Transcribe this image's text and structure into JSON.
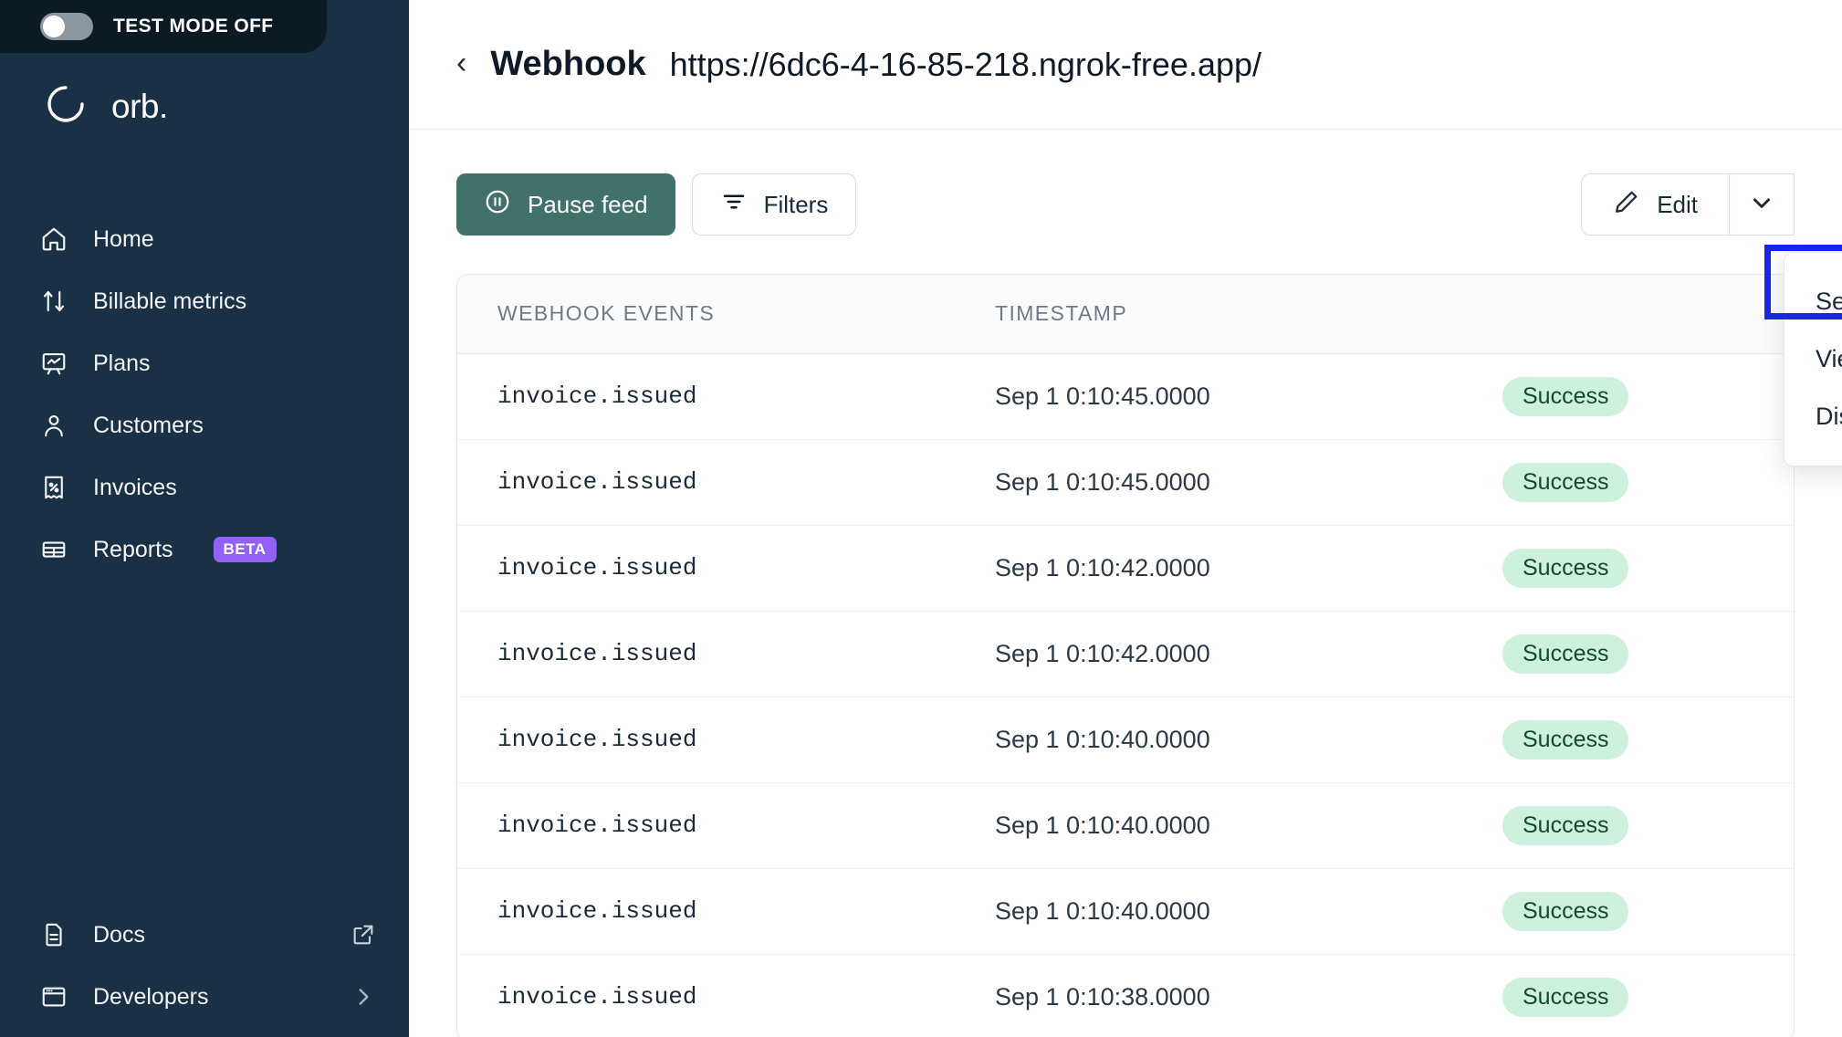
{
  "sidebar": {
    "test_mode": {
      "label": "TEST MODE OFF",
      "state": "off"
    },
    "brand": {
      "name": "orb.",
      "logo_icon": "orb-circle-icon"
    },
    "items": [
      {
        "label": "Home",
        "icon": "home-icon"
      },
      {
        "label": "Billable metrics",
        "icon": "arrows-up-down-icon"
      },
      {
        "label": "Plans",
        "icon": "presentation-chart-icon"
      },
      {
        "label": "Customers",
        "icon": "users-icon"
      },
      {
        "label": "Invoices",
        "icon": "invoice-receipt-icon"
      },
      {
        "label": "Reports",
        "icon": "table-icon",
        "badge": "BETA"
      }
    ],
    "bottom_items": [
      {
        "label": "Docs",
        "icon": "document-icon",
        "trailing_icon": "external-link-icon"
      },
      {
        "label": "Developers",
        "icon": "browser-window-icon",
        "trailing_icon": "chevron-right-icon"
      }
    ]
  },
  "header": {
    "back_icon": "chevron-left-icon",
    "title": "Webhook",
    "url": "https://6dc6-4-16-85-218.ngrok-free.app/"
  },
  "toolbar": {
    "pause_label": "Pause feed",
    "pause_icon": "pause-circle-icon",
    "filters_label": "Filters",
    "filters_icon": "filter-icon",
    "edit_label": "Edit",
    "edit_icon": "pencil-icon",
    "caret_icon": "chevron-down-icon"
  },
  "dropdown": {
    "items": [
      {
        "label": "Send test request",
        "highlighted": true
      },
      {
        "label": "View signing secret",
        "highlighted": false
      },
      {
        "label": "Disable webhook",
        "highlighted": false
      }
    ],
    "highlight_color": "#1726E8"
  },
  "table": {
    "columns": [
      "WEBHOOK EVENTS",
      "TIMESTAMP",
      ""
    ],
    "rows": [
      {
        "event": "invoice.issued",
        "timestamp": "Sep 1 0:10:45.0000",
        "status": "Success"
      },
      {
        "event": "invoice.issued",
        "timestamp": "Sep 1 0:10:45.0000",
        "status": "Success"
      },
      {
        "event": "invoice.issued",
        "timestamp": "Sep 1 0:10:42.0000",
        "status": "Success"
      },
      {
        "event": "invoice.issued",
        "timestamp": "Sep 1 0:10:42.0000",
        "status": "Success"
      },
      {
        "event": "invoice.issued",
        "timestamp": "Sep 1 0:10:40.0000",
        "status": "Success"
      },
      {
        "event": "invoice.issued",
        "timestamp": "Sep 1 0:10:40.0000",
        "status": "Success"
      },
      {
        "event": "invoice.issued",
        "timestamp": "Sep 1 0:10:40.0000",
        "status": "Success"
      },
      {
        "event": "invoice.issued",
        "timestamp": "Sep 1 0:10:38.0000",
        "status": "Success"
      }
    ]
  },
  "colors": {
    "sidebar_bg": "#1A3145",
    "test_bar_bg": "#0C1A24",
    "accent_teal": "#41716B",
    "badge_purple": "#9361F7",
    "success_bg": "#CDF1DC",
    "success_text": "#15492C"
  }
}
